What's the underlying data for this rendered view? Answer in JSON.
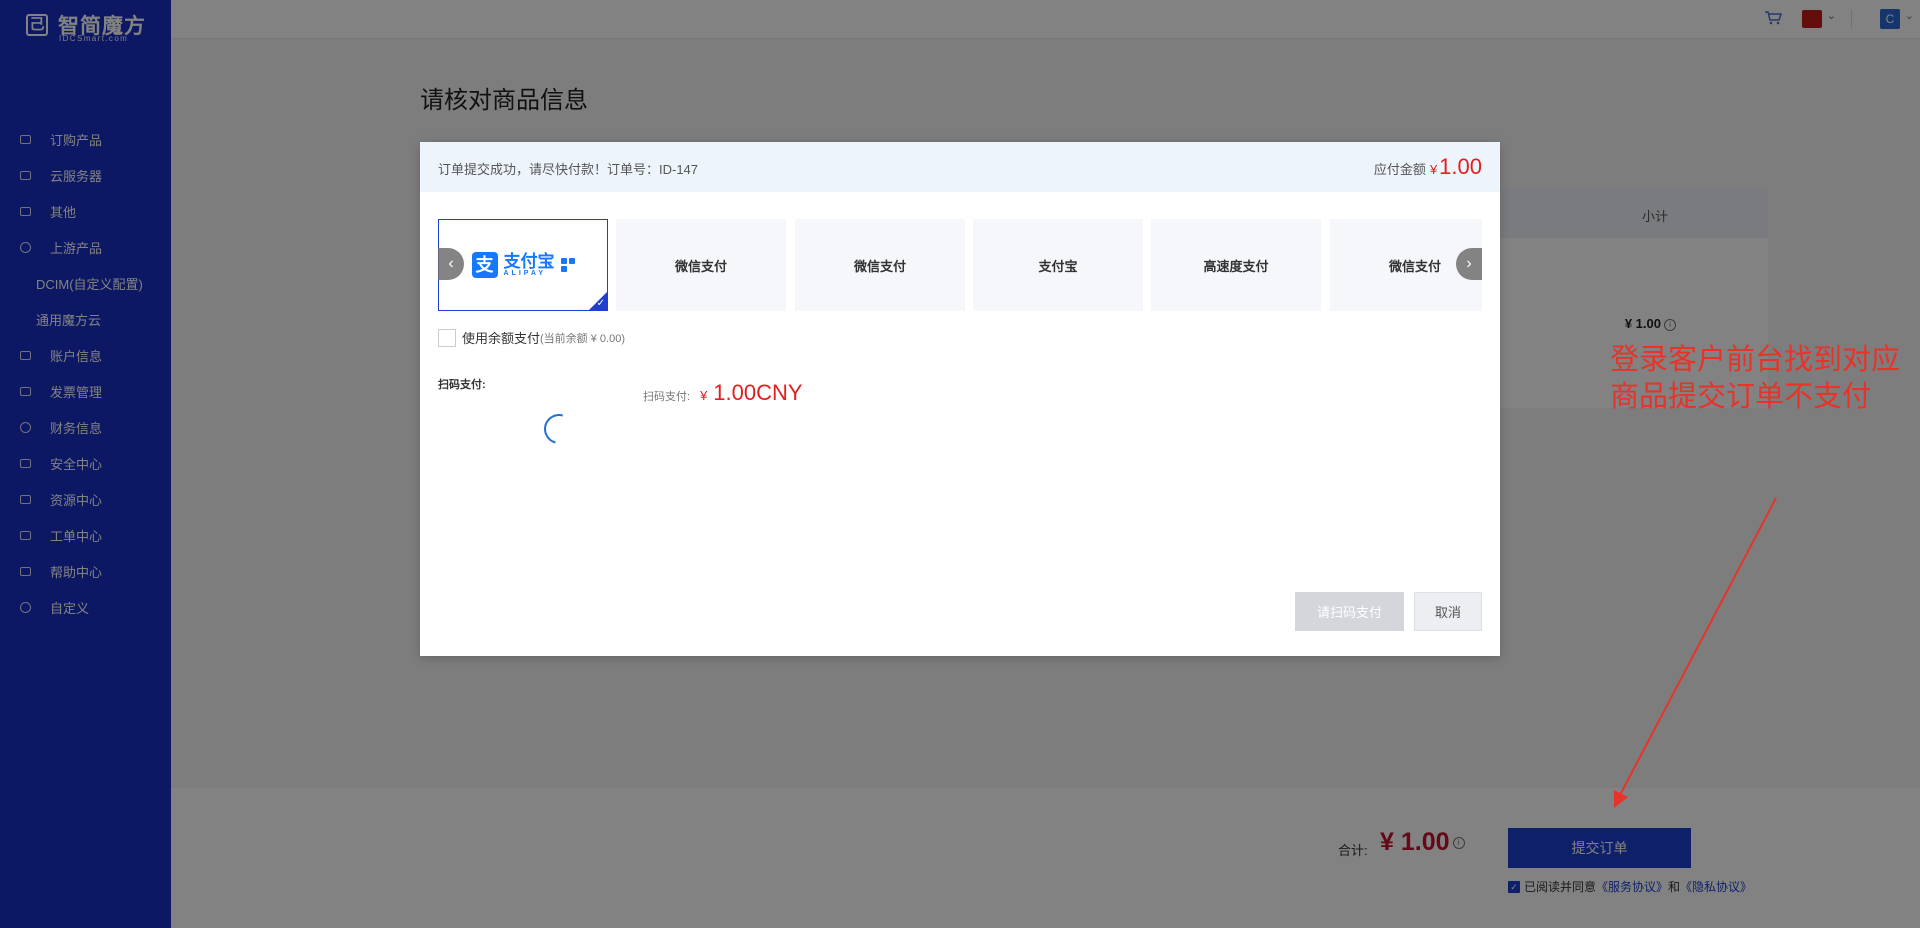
{
  "brand": {
    "mark": "己",
    "name": "智简魔方",
    "sub": "IDCSmart.com"
  },
  "sidebar": {
    "items": [
      {
        "label": "订购产品"
      },
      {
        "label": "云服务器"
      },
      {
        "label": "其他"
      },
      {
        "label": "上游产品"
      },
      {
        "label": "DCIM(自定义配置)"
      },
      {
        "label": "通用魔方云"
      },
      {
        "label": "账户信息"
      },
      {
        "label": "发票管理"
      },
      {
        "label": "财务信息"
      },
      {
        "label": "安全中心"
      },
      {
        "label": "资源中心"
      },
      {
        "label": "工单中心"
      },
      {
        "label": "帮助中心"
      },
      {
        "label": "自定义"
      }
    ]
  },
  "header": {
    "avatar_letter": "C",
    "chevron": "⌄",
    "cart_icon": "cart-icon",
    "flag_color": "#c41a1a"
  },
  "page": {
    "title": "请核对商品信息",
    "table_col_subtotal": "小计",
    "row_subtotal": "¥ 1.00",
    "info_glyph": "i"
  },
  "footer": {
    "total_label": "合计:",
    "total_value": "¥ 1.00",
    "submit_label": "提交订单",
    "agree_prefix": "已阅读并同意",
    "service_link": "《服务协议》",
    "and_text": "和",
    "privacy_link": "《隐私协议》"
  },
  "modal": {
    "notice": "订单提交成功，请尽快付款！订单号：ID-147",
    "payable_label": "应付金额",
    "payable_currency": "¥",
    "payable_value": "1.00",
    "alipay_logo": {
      "char": "支",
      "cn": "支付宝",
      "en": "ALIPAY"
    },
    "methods": [
      "微信支付",
      "微信支付",
      "支付宝",
      "高速度支付",
      "微信支付"
    ],
    "arrow_left": "‹",
    "arrow_right": "›",
    "tick": "✓",
    "use_balance": "使用余额支付",
    "balance_note": "(当前余额 ¥ 0.00)",
    "scan_title": "扫码支付:",
    "scan_label": "扫码支付:",
    "scan_currency": "¥",
    "scan_value": "1.00CNY",
    "pay_button": "请扫码支付",
    "cancel_button": "取消"
  },
  "annotation": {
    "line1": "登录客户前台找到对应",
    "line2": "商品提交订单不支付",
    "color": "#e8332a"
  },
  "colors": {
    "sidebar": "#1a2fc4",
    "accent": "#1f3fd0",
    "price": "#e02020"
  }
}
